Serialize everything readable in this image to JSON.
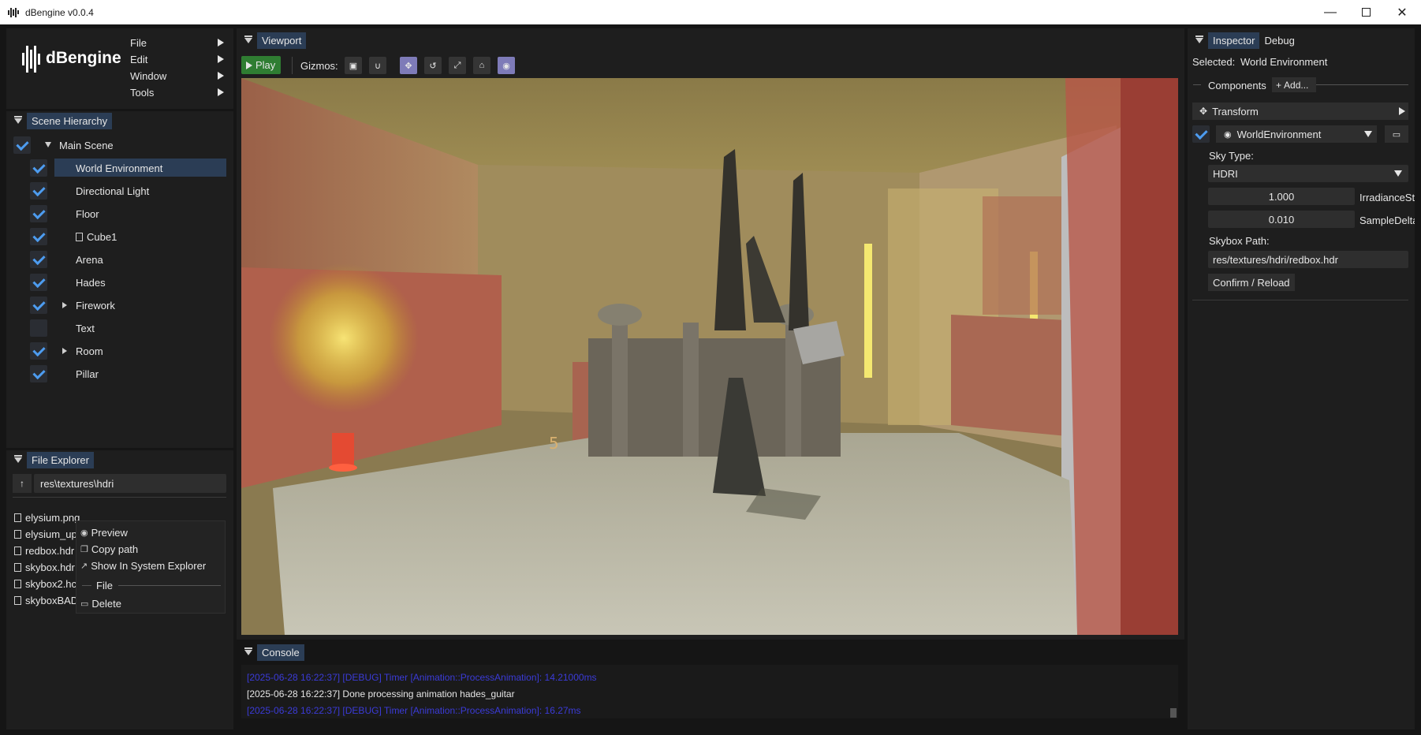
{
  "window": {
    "title": "dBengine v0.0.4",
    "controls": [
      "minimize",
      "maximize",
      "close"
    ]
  },
  "logo": {
    "text": "dBengine"
  },
  "menu": [
    {
      "label": "File"
    },
    {
      "label": "Edit"
    },
    {
      "label": "Window"
    },
    {
      "label": "Tools"
    }
  ],
  "scene_hierarchy": {
    "tab": "Scene Hierarchy",
    "root": "Main Scene",
    "items": [
      {
        "label": "World Environment",
        "checked": true,
        "selected": true
      },
      {
        "label": "Directional Light",
        "checked": true
      },
      {
        "label": "Floor",
        "checked": true
      },
      {
        "label": "Cube1",
        "checked": true,
        "icon": "file-icon"
      },
      {
        "label": "Arena",
        "checked": true
      },
      {
        "label": "Hades",
        "checked": true
      },
      {
        "label": "Firework",
        "checked": true,
        "expandable": true
      },
      {
        "label": "Text",
        "checked": false
      },
      {
        "label": "Room",
        "checked": true,
        "expandable": true
      },
      {
        "label": "Pillar",
        "checked": true
      }
    ]
  },
  "file_explorer": {
    "tab": "File Explorer",
    "path": "res\\textures\\hdri",
    "files": [
      "elysium.png",
      "elysium_up",
      "redbox.hdr",
      "skybox.hdr",
      "skybox2.hc",
      "skyboxBAD"
    ],
    "context_menu": {
      "preview": "Preview",
      "copy_path": "Copy path",
      "show_in_explorer": "Show In System Explorer",
      "file_section": "File",
      "delete": "Delete"
    }
  },
  "viewport": {
    "tab": "Viewport",
    "play_label": "Play",
    "gizmos_label": "Gizmos:",
    "tools": [
      {
        "icon": "cube-icon",
        "active": false
      },
      {
        "icon": "magnet-icon",
        "active": false
      },
      {
        "icon": "move-icon",
        "active": true
      },
      {
        "icon": "rotate-icon",
        "active": false
      },
      {
        "icon": "scale-icon",
        "active": false
      },
      {
        "icon": "home-icon",
        "active": false
      },
      {
        "icon": "globe-icon",
        "active": true
      }
    ],
    "scene_marks": {
      "seat_number": "5"
    }
  },
  "console": {
    "tab": "Console",
    "lines": [
      {
        "text": "[2025-06-28 16:22:37] [DEBUG] Timer [Animation::ProcessAnimation]: 14.21000ms",
        "color": "#3b3bd8"
      },
      {
        "text": "[2025-06-28 16:22:37] Done processing animation hades_guitar",
        "color": "#e6e6e6"
      },
      {
        "text": "[2025-06-28 16:22:37] [DEBUG] Timer [Animation::ProcessAnimation]: 16.27ms",
        "color": "#3b3bd8"
      }
    ]
  },
  "inspector": {
    "tabs": [
      "Inspector",
      "Debug"
    ],
    "selected_label": "Selected:",
    "selected_value": "World Environment",
    "components_label": "Components",
    "add_label": "Add...",
    "transform_label": "Transform",
    "component_name": "WorldEnvironment",
    "sky_type_label": "Sky Type:",
    "sky_type_value": "HDRI",
    "irradiance_value": "1.000",
    "irradiance_label": "IrradianceStr",
    "sample_value": "0.010",
    "sample_label": "SampleDelta",
    "skybox_path_label": "Skybox Path:",
    "skybox_path_value": "res/textures/hdri/redbox.hdr",
    "confirm_label": "Confirm / Reload"
  },
  "colors": {
    "accent": "#4d9cf0",
    "selection": "#2b3d55",
    "play": "#2f7d32",
    "active_tool": "#7e7bb8"
  }
}
